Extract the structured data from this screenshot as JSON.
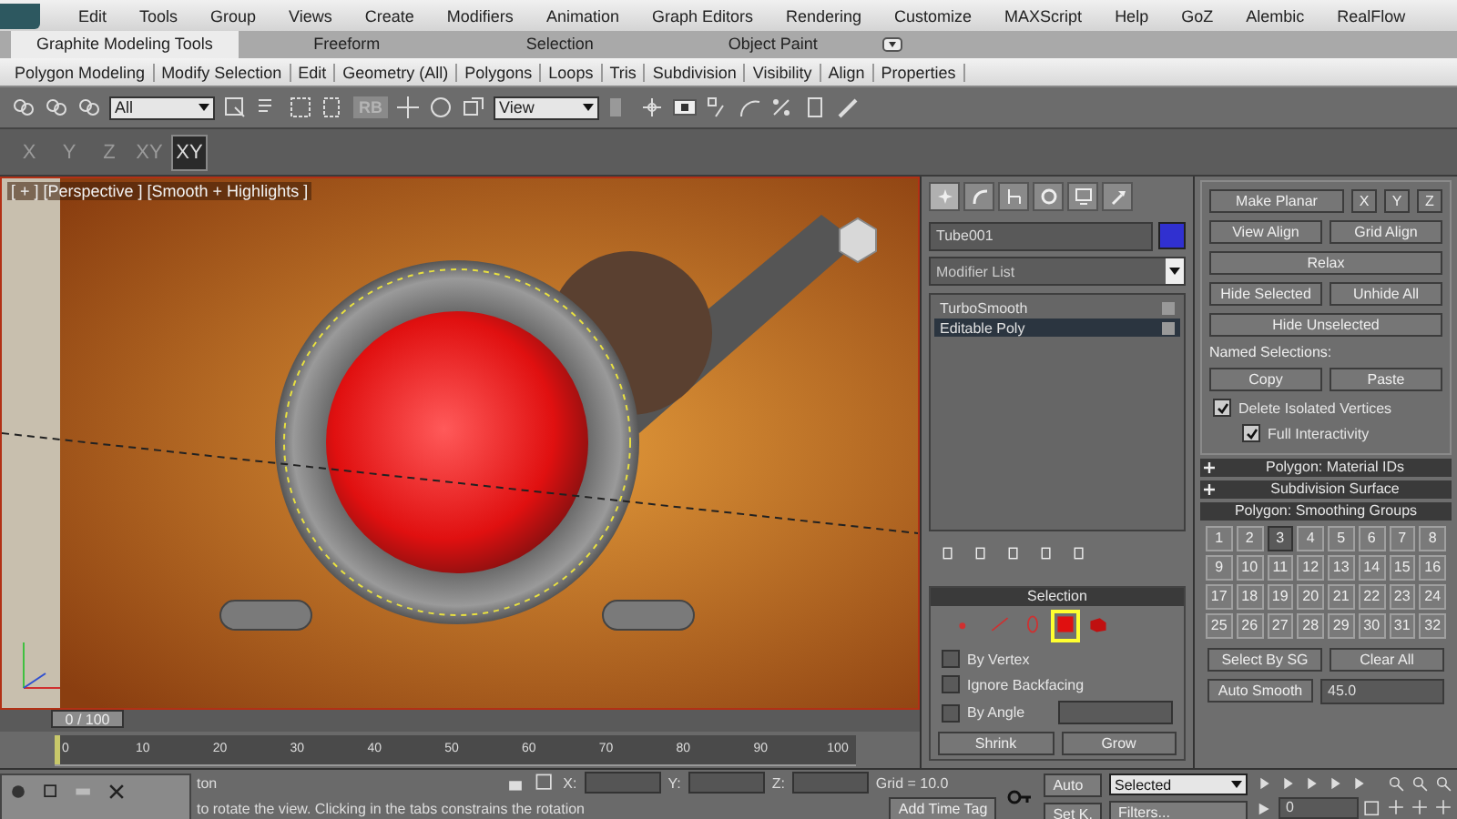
{
  "menu": [
    "Edit",
    "Tools",
    "Group",
    "Views",
    "Create",
    "Modifiers",
    "Animation",
    "Graph Editors",
    "Rendering",
    "Customize",
    "MAXScript",
    "Help",
    "GoZ",
    "Alembic",
    "RealFlow"
  ],
  "ribbon_tabs": [
    {
      "label": "Graphite Modeling Tools",
      "selected": true
    },
    {
      "label": "Freeform",
      "selected": false
    },
    {
      "label": "Selection",
      "selected": false
    },
    {
      "label": "Object Paint",
      "selected": false
    }
  ],
  "ribbon_panels": [
    "Polygon Modeling",
    "Modify Selection",
    "Edit",
    "Geometry (All)",
    "Polygons",
    "Loops",
    "Tris",
    "Subdivision",
    "Visibility",
    "Align",
    "Properties"
  ],
  "toolbar": {
    "selection_filter": "All",
    "rb_label": "RB",
    "coord_system": "View"
  },
  "axis_buttons": [
    {
      "label": "X",
      "selected": false
    },
    {
      "label": "Y",
      "selected": false
    },
    {
      "label": "Z",
      "selected": false
    },
    {
      "label": "XY",
      "selected": false
    },
    {
      "label": "XY",
      "selected": true
    }
  ],
  "viewport": {
    "label": "[ + ] [Perspective ] [Smooth + Highlights ]"
  },
  "command_panel": {
    "tabs": [
      {
        "selected": true
      },
      {
        "selected": false
      },
      {
        "selected": false
      },
      {
        "selected": false
      },
      {
        "selected": false
      },
      {
        "selected": false
      }
    ],
    "object_name": "Tube001",
    "modifier_list": "Modifier List",
    "stack": [
      {
        "name": "TurboSmooth",
        "selected": false
      },
      {
        "name": "Editable Poly",
        "selected": true
      }
    ],
    "selection": {
      "title": "Selection",
      "options": [
        {
          "label": "By Vertex",
          "checked": false
        },
        {
          "label": "Ignore Backfacing",
          "checked": false
        },
        {
          "label": "By Angle",
          "checked": false
        }
      ],
      "buttons": [
        "Shrink",
        "Grow"
      ]
    }
  },
  "edit_geometry": {
    "rows": [
      [
        "Make Planar",
        "X",
        "Y",
        "Z"
      ],
      [
        "View Align",
        "Grid Align"
      ],
      [
        "Relax"
      ],
      [
        "Hide Selected",
        "Unhide All"
      ],
      [
        "Hide Unselected"
      ]
    ],
    "named_selections": "Named Selections:",
    "named_buttons": [
      "Copy",
      "Paste"
    ],
    "options": [
      {
        "label": "Delete Isolated Vertices",
        "checked": true
      },
      {
        "label": "Full Interactivity",
        "checked": true
      }
    ]
  },
  "rollouts": [
    "Polygon: Material IDs",
    "Subdivision Surface"
  ],
  "smoothing_groups": {
    "title": "Polygon: Smoothing Groups",
    "groups": [
      {
        "label": "1",
        "selected": false
      },
      {
        "label": "2",
        "selected": false
      },
      {
        "label": "3",
        "selected": true
      },
      {
        "label": "4",
        "selected": false
      },
      {
        "label": "5",
        "selected": false
      },
      {
        "label": "6",
        "selected": false
      },
      {
        "label": "7",
        "selected": false
      },
      {
        "label": "8",
        "selected": false
      },
      {
        "label": "9",
        "selected": false
      },
      {
        "label": "10",
        "selected": false
      },
      {
        "label": "11",
        "selected": false
      },
      {
        "label": "12",
        "selected": false
      },
      {
        "label": "13",
        "selected": false
      },
      {
        "label": "14",
        "selected": false
      },
      {
        "label": "15",
        "selected": false
      },
      {
        "label": "16",
        "selected": false
      },
      {
        "label": "17",
        "selected": false
      },
      {
        "label": "18",
        "selected": false
      },
      {
        "label": "19",
        "selected": false
      },
      {
        "label": "20",
        "selected": false
      },
      {
        "label": "21",
        "selected": false
      },
      {
        "label": "22",
        "selected": false
      },
      {
        "label": "23",
        "selected": false
      },
      {
        "label": "24",
        "selected": false
      },
      {
        "label": "25",
        "selected": false
      },
      {
        "label": "26",
        "selected": false
      },
      {
        "label": "27",
        "selected": false
      },
      {
        "label": "28",
        "selected": false
      },
      {
        "label": "29",
        "selected": false
      },
      {
        "label": "30",
        "selected": false
      },
      {
        "label": "31",
        "selected": false
      },
      {
        "label": "32",
        "selected": false
      }
    ],
    "buttons": [
      "Select By SG",
      "Clear All"
    ],
    "auto_smooth": "Auto Smooth",
    "threshold": "45.0"
  },
  "timeline": {
    "slider": "0 / 100",
    "ticks": [
      "0",
      "10",
      "20",
      "30",
      "40",
      "50",
      "60",
      "70",
      "80",
      "90",
      "100"
    ]
  },
  "status_bar": {
    "status": "ton",
    "prompt": "to rotate the view. Clicking in the tabs constrains the rotation",
    "x_label": "X:",
    "y_label": "Y:",
    "z_label": "Z:",
    "grid": "Grid = 10.0",
    "add_time_tag": "Add Time Tag",
    "auto_key": "Auto",
    "set_key": "Set K.",
    "key_filter": "Selected",
    "filters": "Filters...",
    "frame": "0"
  }
}
